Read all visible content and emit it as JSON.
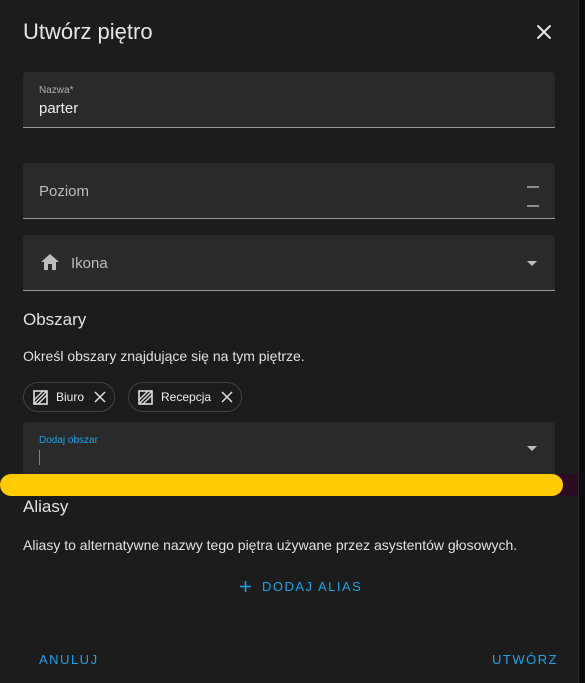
{
  "dialog": {
    "title": "Utwórz piętro"
  },
  "fields": {
    "name_label": "Nazwa*",
    "name_value": "parter",
    "level_label": "Poziom",
    "icon_label": "Ikona",
    "areas_input_label": "Dodaj obszar"
  },
  "areas": {
    "title": "Obszary",
    "description": "Określ obszary znajdujące się na tym piętrze.",
    "chips": [
      "Biuro",
      "Recepcja"
    ]
  },
  "aliases": {
    "title": "Aliasy",
    "description": "Aliasy to alternatywne nazwy tego piętra używane przez asystentów głosowych.",
    "add_label": "DODAJ ALIAS"
  },
  "actions": {
    "cancel": "ANULUJ",
    "create": "UTWÓRZ"
  },
  "colors": {
    "accent": "#1aa3e8",
    "highlight": "#ffcb00",
    "surface": "#1c1c1c",
    "field": "#2a2a2a"
  },
  "icons": [
    "close-icon",
    "home-icon",
    "chevron-down-icon",
    "area-icon",
    "remove-chip-icon",
    "plus-icon",
    "number-stepper-icon"
  ]
}
